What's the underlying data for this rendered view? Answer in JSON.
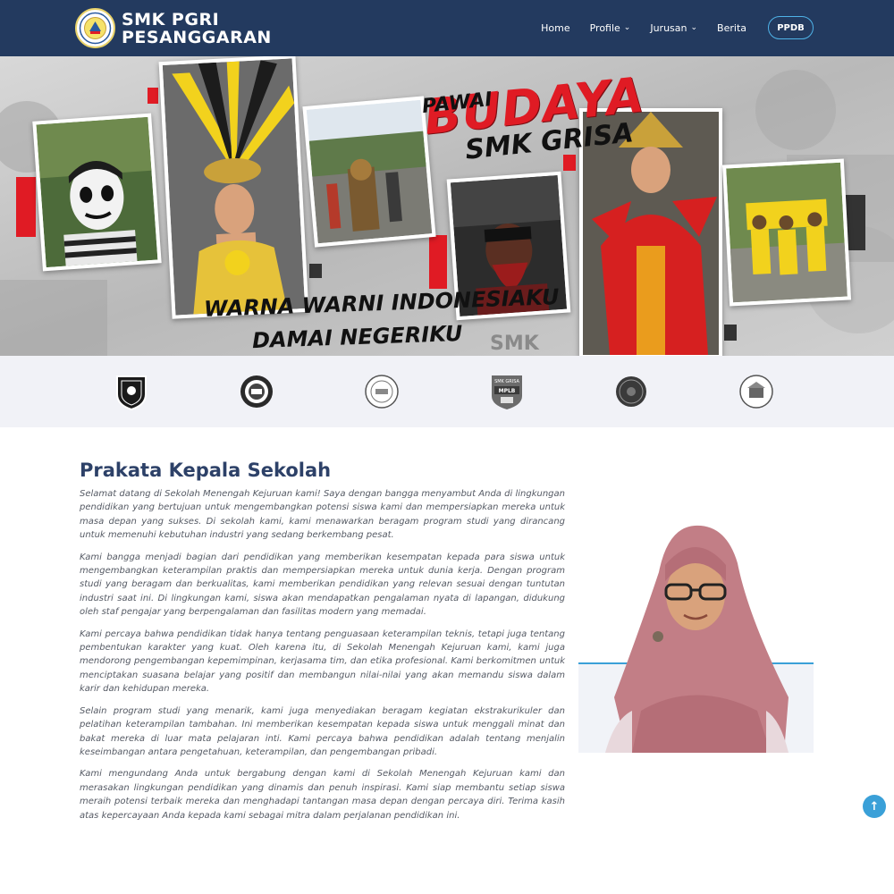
{
  "navbar": {
    "brand_line1": "SMK PGRI",
    "brand_line2": "PESANGGARAN",
    "items": [
      {
        "label": "Home",
        "dropdown": false
      },
      {
        "label": "Profile",
        "dropdown": true
      },
      {
        "label": "Jurusan",
        "dropdown": true
      },
      {
        "label": "Berita",
        "dropdown": false
      }
    ],
    "ppdb_label": "PPDB",
    "accent": "#4fb3e8",
    "bg": "#233a5f"
  },
  "hero": {
    "pawai": "PAWAI",
    "budaya": "BUDAYA",
    "smk_grisa": "SMK GRISA",
    "warna": "WARNA WARNI INDONESIAKU",
    "damai": "DAMAI NEGERIKU",
    "watermark": "SMK"
  },
  "partners": [
    {
      "icon": "shield-emblem-icon"
    },
    {
      "icon": "gear-emblem-icon"
    },
    {
      "icon": "round-seal-icon"
    },
    {
      "icon": "mplb-badge-icon",
      "text_top": "SMK GRISA",
      "text_mid": "MPLB"
    },
    {
      "icon": "dark-seal-icon"
    },
    {
      "icon": "perhotelan-seal-icon"
    }
  ],
  "prakata": {
    "title": "Prakata Kepala Sekolah",
    "paragraphs": [
      "Selamat datang di Sekolah Menengah Kejuruan kami! Saya dengan bangga menyambut Anda di lingkungan pendidikan yang bertujuan untuk mengembangkan potensi siswa kami dan mempersiapkan mereka untuk masa depan yang sukses. Di sekolah kami, kami menawarkan beragam program studi yang dirancang untuk memenuhi kebutuhan industri yang sedang berkembang pesat.",
      "Kami bangga menjadi bagian dari pendidikan yang memberikan kesempatan kepada para siswa untuk mengembangkan keterampilan praktis dan mempersiapkan mereka untuk dunia kerja. Dengan program studi yang beragam dan berkualitas, kami memberikan pendidikan yang relevan sesuai dengan tuntutan industri saat ini. Di lingkungan kami, siswa akan mendapatkan pengalaman nyata di lapangan, didukung oleh staf pengajar yang berpengalaman dan fasilitas modern yang memadai.",
      "Kami percaya bahwa pendidikan tidak hanya tentang penguasaan keterampilan teknis, tetapi juga tentang pembentukan karakter yang kuat. Oleh karena itu, di Sekolah Menengah Kejuruan kami, kami juga mendorong pengembangan kepemimpinan, kerjasama tim, dan etika profesional. Kami berkomitmen untuk menciptakan suasana belajar yang positif dan membangun nilai-nilai yang akan memandu siswa dalam karir dan kehidupan mereka.",
      "Selain program studi yang menarik, kami juga menyediakan beragam kegiatan ekstrakurikuler dan pelatihan keterampilan tambahan. Ini memberikan kesempatan kepada siswa untuk menggali minat dan bakat mereka di luar mata pelajaran inti. Kami percaya bahwa pendidikan adalah tentang menjalin keseimbangan antara pengetahuan, keterampilan, dan pengembangan pribadi.",
      "Kami mengundang Anda untuk bergabung dengan kami di Sekolah Menengah Kejuruan kami dan merasakan lingkungan pendidikan yang dinamis dan penuh inspirasi. Kami siap membantu setiap siswa meraih potensi terbaik mereka dan menghadapi tantangan masa depan dengan percaya diri. Terima kasih atas kepercayaan Anda kepada kami sebagai mitra dalam perjalanan pendidikan ini."
    ]
  },
  "colors": {
    "title": "#2d4168",
    "body_text": "#555a64",
    "accent_line": "#3aa0d8"
  },
  "scroll_top_icon": "arrow-up-icon"
}
